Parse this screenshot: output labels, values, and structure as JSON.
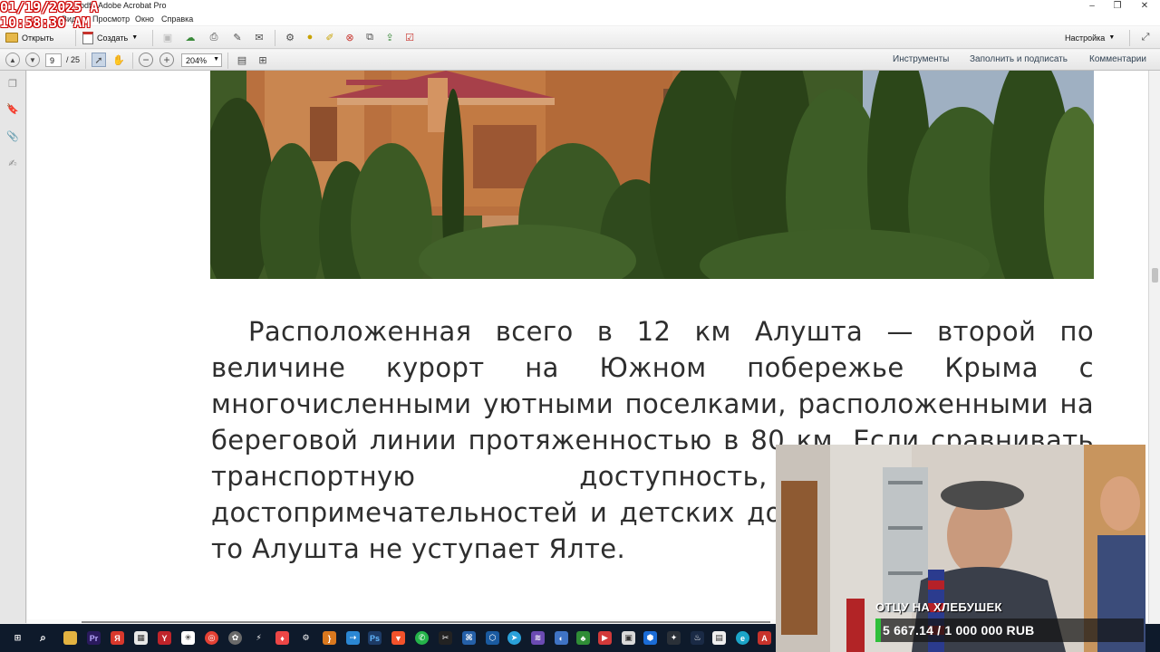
{
  "window": {
    "title": "pdf - Adobe Acrobat Pro",
    "menu": [
      "Вид",
      "Просмотр",
      "Окно",
      "Справка"
    ]
  },
  "timestamp_overlay": {
    "date": "01/19/2025 A",
    "time": "10:58:30 AM"
  },
  "toolbar": {
    "open_label": "Открыть",
    "create_label": "Создать",
    "customize_label": "Настройка"
  },
  "nav": {
    "page_current": "9",
    "page_total": "/ 25",
    "zoom": "204%",
    "tools_link": "Инструменты",
    "fill_sign_link": "Заполнить и подписать",
    "comments_link": "Комментарии"
  },
  "document": {
    "paragraph": "Расположенная всего в 12 км Алушта — второй по величине курорт на Южном побережье Крыма с многочисленными уютными поселками, расположенными на береговой линии протяженностью в 80 км. Если сравнивать транспортную доступность, количество достопримечательностей и детских досуговых учреждений, то Алушта не уступает Ялте."
  },
  "stream_overlay": {
    "donation_title": "ОТЦУ НА ХЛЕБУШЕК",
    "donation_amount": "5 667.14 / 1 000 000 RUB",
    "donation_progress": 0.0057,
    "bar_color": "#2fbf3a"
  },
  "taskbar": {
    "icons": [
      "start-icon",
      "search-icon",
      "file-explorer-icon",
      "premiere-icon",
      "yandex-icon",
      "calculator-icon",
      "yandex-browser-icon",
      "chrome-icon",
      "browser-icon",
      "media-icon",
      "settings-icon",
      "brackets-icon",
      "bolt-icon",
      "photoshop-icon",
      "brave-icon",
      "whatsapp-icon",
      "capcut-icon",
      "network-icon",
      "telegram-icon",
      "app-icon",
      "app-icon",
      "steam-icon",
      "app-icon",
      "edge-icon"
    ]
  }
}
